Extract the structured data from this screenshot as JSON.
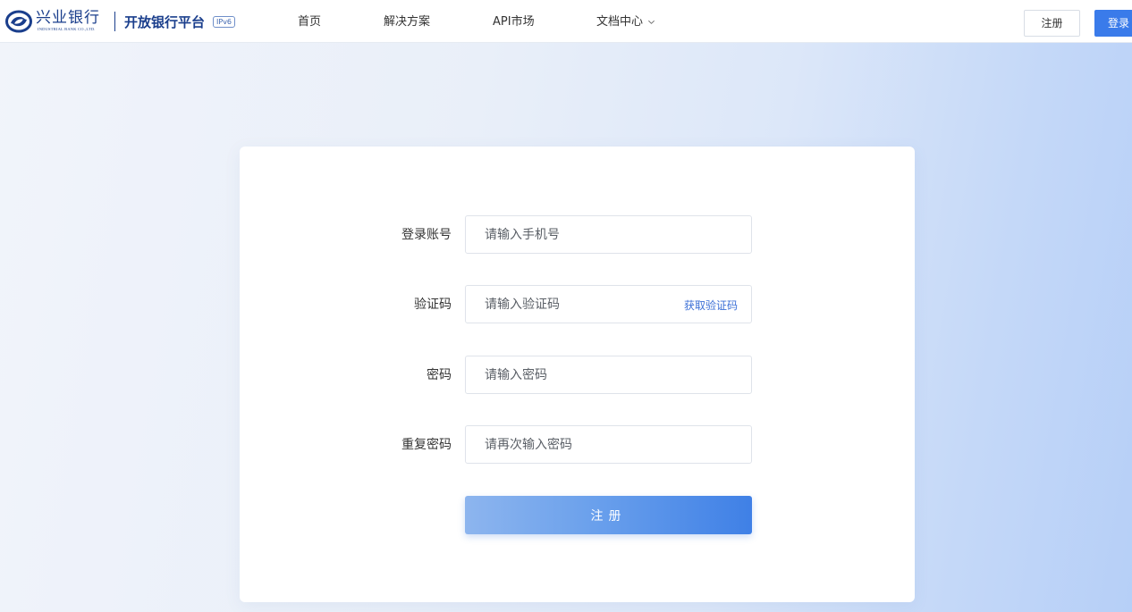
{
  "brand": {
    "bank_name_cn": "兴业银行",
    "bank_name_en": "INDUSTRIAL BANK CO.,LTD.",
    "platform_name": "开放银行平台",
    "ipv6_badge": "IPv6",
    "logo_icon": "bank-swirl-logo-icon",
    "brand_color": "#1a3e8c"
  },
  "nav": {
    "items": [
      {
        "label": "首页"
      },
      {
        "label": "解决方案"
      },
      {
        "label": "API市场"
      },
      {
        "label": "文档中心",
        "icon": "chevron-down-icon"
      }
    ]
  },
  "header_actions": {
    "register_label": "注册",
    "login_label": "登录",
    "accent_color": "#3a7bea"
  },
  "form": {
    "account": {
      "label": "登录账号",
      "placeholder": "请输入手机号",
      "value": ""
    },
    "code": {
      "label": "验证码",
      "placeholder": "请输入验证码",
      "value": "",
      "get_code_label": "获取验证码"
    },
    "password": {
      "label": "密码",
      "placeholder": "请输入密码",
      "value": ""
    },
    "confirm_password": {
      "label": "重复密码",
      "placeholder": "请再次输入密码",
      "value": ""
    },
    "submit_label": "注册"
  }
}
